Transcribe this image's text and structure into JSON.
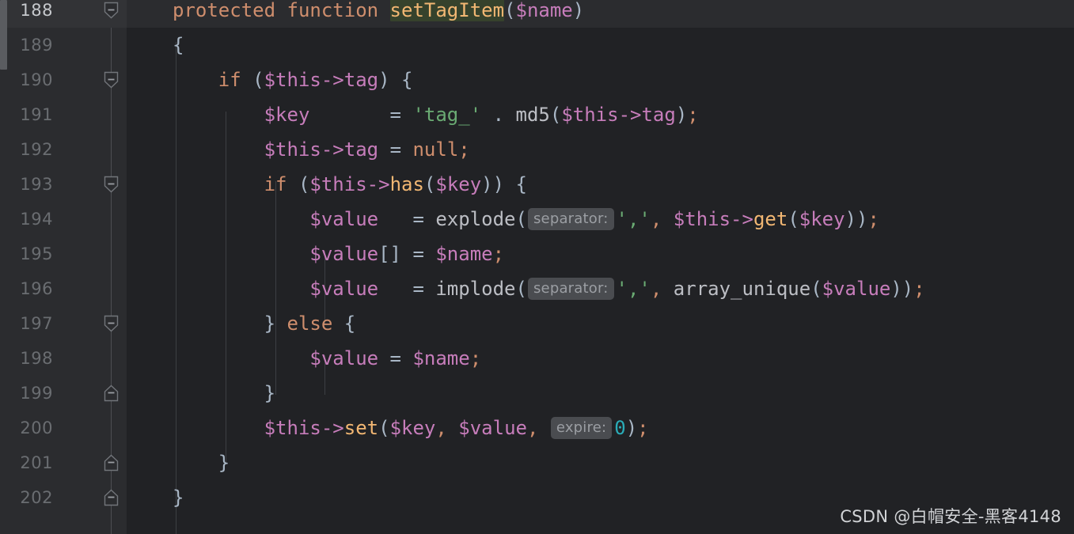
{
  "editor": {
    "language": "PHP",
    "theme": "Darcula",
    "background_color": "#212225",
    "gutter_color": "#2b2c2f",
    "current_line_color": "#2b2c2f",
    "first_visible_line": 188,
    "last_visible_line": 202,
    "current_line": 188,
    "docblock_tail": "/"
  },
  "palette": {
    "keyword": "#cf8e6d",
    "function_name": "#f2b773",
    "variable": "#c77dbb",
    "string": "#6aab73",
    "number": "#2aacb8",
    "punctuation": "#a9b7c6",
    "default_text": "#bcbec4",
    "inlay_hint_bg": "#4a4c50",
    "inlay_hint_text": "#9b9ea3",
    "identifier_highlight_bg": "#36422c",
    "line_number": "#6a6d71",
    "line_number_current": "#c6c9cd",
    "indent_guide": "#3d3f43",
    "lightbulb": "#f0a732",
    "scrollbar_thumb": "#5a5c60"
  },
  "gutter": {
    "icons": [
      {
        "line": 188,
        "name": "intention-bulb-icon",
        "type": "lightbulb"
      }
    ],
    "line_numbers": [
      188,
      189,
      190,
      191,
      192,
      193,
      194,
      195,
      196,
      197,
      198,
      199,
      200,
      201,
      202
    ],
    "fold_markers": [
      {
        "line": 188,
        "direction": "expanded-start"
      },
      {
        "line": 190,
        "direction": "expanded-start"
      },
      {
        "line": 193,
        "direction": "expanded-start"
      },
      {
        "line": 197,
        "direction": "expanded-start"
      },
      {
        "line": 199,
        "direction": "expanded-end"
      },
      {
        "line": 201,
        "direction": "expanded-end"
      },
      {
        "line": 202,
        "direction": "expanded-end"
      }
    ]
  },
  "code": {
    "lines": [
      {
        "n": 188,
        "text": "    protected function setTagItem($name)"
      },
      {
        "n": 189,
        "text": "    {"
      },
      {
        "n": 190,
        "text": "        if ($this->tag) {"
      },
      {
        "n": 191,
        "text": "            $key       = 'tag_' . md5($this->tag);"
      },
      {
        "n": 192,
        "text": "            $this->tag = null;"
      },
      {
        "n": 193,
        "text": "            if ($this->has($key)) {"
      },
      {
        "n": 194,
        "text": "                $value   = explode(separator: ',', $this->get($key));"
      },
      {
        "n": 195,
        "text": "                $value[] = $name;"
      },
      {
        "n": 196,
        "text": "                $value   = implode(separator: ',', array_unique($value));"
      },
      {
        "n": 197,
        "text": "            } else {"
      },
      {
        "n": 198,
        "text": "                $value = $name;"
      },
      {
        "n": 199,
        "text": "            }"
      },
      {
        "n": 200,
        "text": "            $this->set($key, $value, expire: 0);"
      },
      {
        "n": 201,
        "text": "        }"
      },
      {
        "n": 202,
        "text": "    }"
      }
    ]
  },
  "tokens": {
    "kw_protected": "protected",
    "kw_function": "function",
    "kw_if": "if",
    "kw_else": "else",
    "kw_null": "null",
    "fn_setTagItem": "setTagItem",
    "fn_has": "has",
    "fn_get": "get",
    "fn_set": "set",
    "fn_md5": "md5",
    "fn_explode": "explode",
    "fn_implode": "implode",
    "fn_array_unique": "array_unique",
    "var_name": "$name",
    "var_key": "$key",
    "var_value": "$value",
    "var_this": "$this",
    "prop_tag": "tag",
    "str_tag_prefix": "'tag_'",
    "str_comma": "','",
    "num_zero": "0"
  },
  "inlay_hints": [
    {
      "line": 194,
      "label": "separator:"
    },
    {
      "line": 196,
      "label": "separator:"
    },
    {
      "line": 200,
      "label": "expire:"
    }
  ],
  "watermark": {
    "text": "CSDN @白帽安全-黑客4148"
  }
}
